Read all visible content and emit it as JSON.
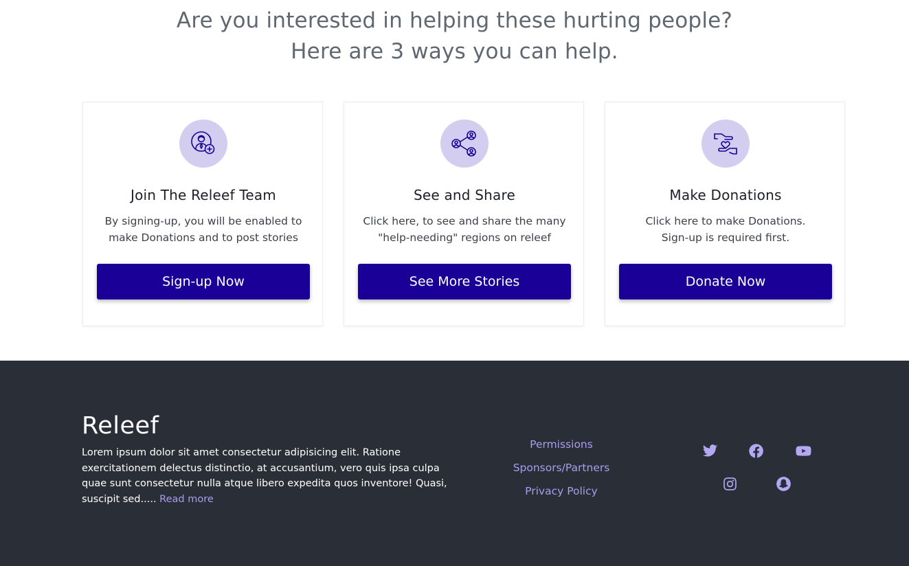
{
  "hero": {
    "title_line1": "Are you interested in helping these hurting people?",
    "title_line2": "Here are 3 ways you can help."
  },
  "cards": [
    {
      "icon": "team-member-add-icon",
      "title": "Join The Releef Team",
      "desc_line1": "By signing-up, you will be enabled to",
      "desc_line2": "make Donations and to post stories",
      "button": "Sign-up Now"
    },
    {
      "icon": "share-network-icon",
      "title": "See and Share",
      "desc_line1": "Click here, to see and share the many",
      "desc_line2": "\"help-needing\" regions on releef",
      "button": "See More Stories"
    },
    {
      "icon": "donation-hand-heart-icon",
      "title": "Make Donations",
      "desc_line1": "Click here to make Donations.",
      "desc_line2": "Sign-up is required first.",
      "button": "Donate Now"
    }
  ],
  "footer": {
    "brand": "Releef",
    "about_line1": "Lorem ipsum dolor sit amet consectetur adipisicing elit. Ratione",
    "about_line2": "exercitationem delectus distinctio, at accusantium, vero quis ipsa culpa",
    "about_line3": "quae sunt consectetur nulla atque libero expedita quos inventore! Quasi,",
    "about_line4": "suscipit sed.....",
    "read_more": "Read more",
    "links": [
      "Permissions",
      "Sponsors/Partners",
      "Privacy Policy"
    ],
    "social": [
      "twitter-icon",
      "facebook-icon",
      "youtube-icon",
      "instagram-icon",
      "snapchat-icon"
    ]
  },
  "colors": {
    "accent_button": "#1a0096",
    "icon_circle": "#d3cdef",
    "footer_bg": "#2a2f37",
    "footer_link": "#a99cf0"
  }
}
